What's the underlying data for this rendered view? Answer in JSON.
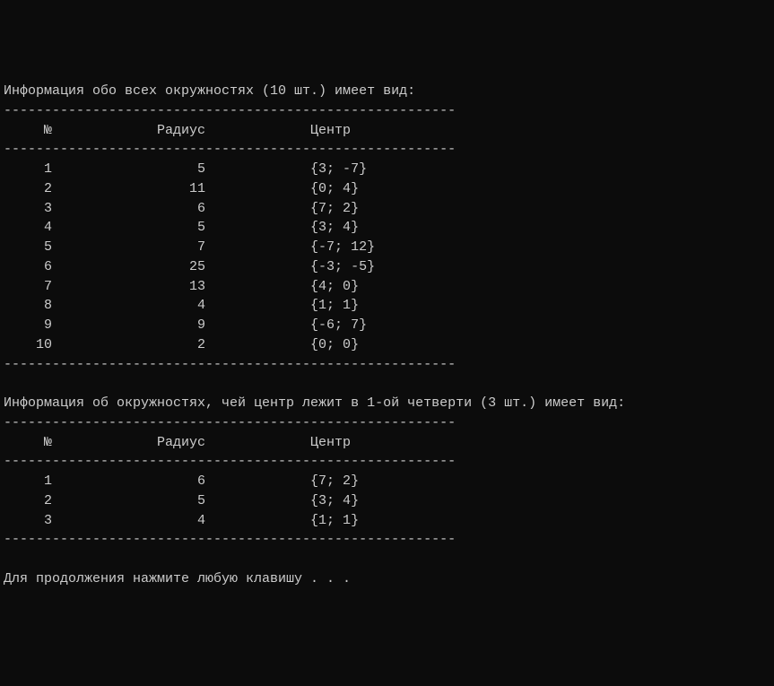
{
  "section1": {
    "title": "Информация обо всех окружностях (10 шт.) имеет вид:",
    "separator": "--------------------------------------------------------",
    "header": "     №             Радиус             Центр",
    "rows": [
      "     1                  5             {3; -7}",
      "     2                 11             {0; 4}",
      "     3                  6             {7; 2}",
      "     4                  5             {3; 4}",
      "     5                  7             {-7; 12}",
      "     6                 25             {-3; -5}",
      "     7                 13             {4; 0}",
      "     8                  4             {1; 1}",
      "     9                  9             {-6; 7}",
      "    10                  2             {0; 0}"
    ]
  },
  "section2": {
    "title": "Информация об окружностях, чей центр лежит в 1-ой четверти (3 шт.) имеет вид:",
    "separator": "--------------------------------------------------------",
    "header": "     №             Радиус             Центр",
    "rows": [
      "     1                  6             {7; 2}",
      "     2                  5             {3; 4}",
      "     3                  4             {1; 1}"
    ]
  },
  "prompt": "Для продолжения нажмите любую клавишу . . .",
  "blank": ""
}
